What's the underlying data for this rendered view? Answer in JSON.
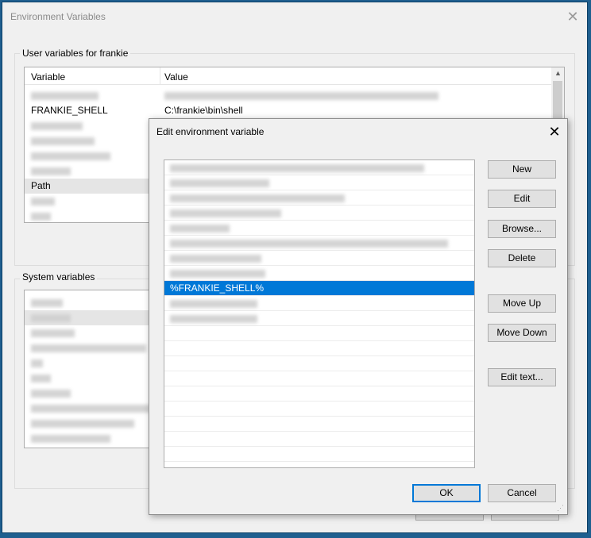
{
  "main_window": {
    "title": "Environment Variables",
    "close_glyph": "✕",
    "user_group": {
      "label": "User variables for frankie",
      "col_variable": "Variable",
      "col_value": "Value",
      "visible_rows": [
        {
          "name": "FRANKIE_SHELL",
          "value": "C:\\frankie\\bin\\shell"
        },
        {
          "name": "Path",
          "value": ""
        }
      ]
    },
    "system_group": {
      "label": "System variables"
    }
  },
  "dialog": {
    "title": "Edit environment variable",
    "close_glyph": "✕",
    "path_entries": [
      {
        "text": "",
        "blurred": true,
        "width": 320
      },
      {
        "text": "",
        "blurred": true,
        "width": 125
      },
      {
        "text": "",
        "blurred": true,
        "width": 220
      },
      {
        "text": "",
        "blurred": true,
        "width": 140
      },
      {
        "text": "",
        "blurred": true,
        "width": 75
      },
      {
        "text": "",
        "blurred": true,
        "width": 350
      },
      {
        "text": "",
        "blurred": true,
        "width": 115
      },
      {
        "text": "",
        "blurred": true,
        "width": 120
      },
      {
        "text": "%FRANKIE_SHELL%",
        "blurred": false,
        "selected": true
      },
      {
        "text": "",
        "blurred": true,
        "width": 110
      },
      {
        "text": "",
        "blurred": true,
        "width": 110
      }
    ],
    "buttons": {
      "new": "New",
      "edit": "Edit",
      "browse": "Browse...",
      "delete": "Delete",
      "move_up": "Move Up",
      "move_down": "Move Down",
      "edit_text": "Edit text...",
      "ok": "OK",
      "cancel": "Cancel"
    }
  },
  "colors": {
    "selection": "#0078d7",
    "window_bg": "#f0f0f0",
    "desktop": "#1f5f8f"
  }
}
